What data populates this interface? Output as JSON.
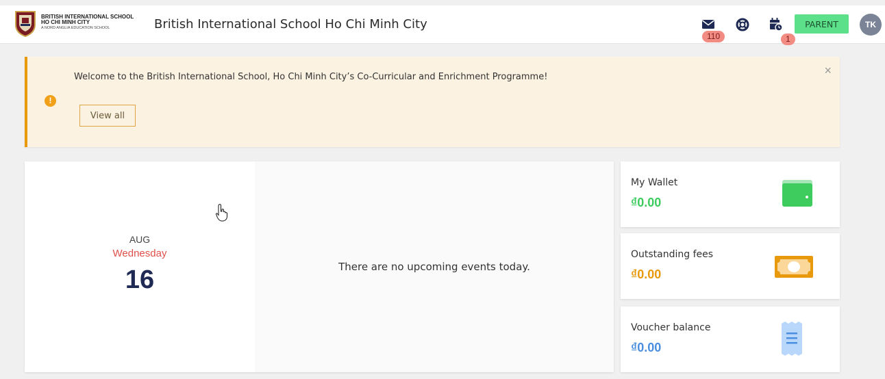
{
  "header": {
    "logo_line1": "BRITISH INTERNATIONAL SCHOOL",
    "logo_line2": "HO CHI MINH CITY",
    "logo_line3": "A NORD ANGLIA EDUCATION SCHOOL",
    "school_name": "British International School Ho Chi Minh City",
    "mail_count": "110",
    "events_count": "1",
    "role_button": "PARENT",
    "avatar_initials": "TK"
  },
  "banner": {
    "message": "Welcome to the British International School, Ho Chi Minh City’s Co-Curricular and Enrichment Programme!",
    "view_all_label": "View all",
    "close_symbol": "×",
    "alert_symbol": "!"
  },
  "calendar": {
    "month": "AUG",
    "weekday": "Wednesday",
    "day": "16",
    "no_events_text": "There are no upcoming events today."
  },
  "cards": [
    {
      "title": "My Wallet",
      "value": "₫0.00",
      "color": "#3ecc5f",
      "icon": "wallet-icon"
    },
    {
      "title": "Outstanding fees",
      "value": "₫0.00",
      "color": "#e89a0c",
      "icon": "banknote-icon"
    },
    {
      "title": "Voucher balance",
      "value": "₫0.00",
      "color": "#4a8fe0",
      "icon": "receipt-icon"
    }
  ],
  "colors": {
    "accent_orange": "#e89a0c",
    "parent_green": "#5ce08a",
    "badge_red": "#f28b82",
    "date_red": "#e0504a",
    "date_navy": "#1f2a54"
  }
}
